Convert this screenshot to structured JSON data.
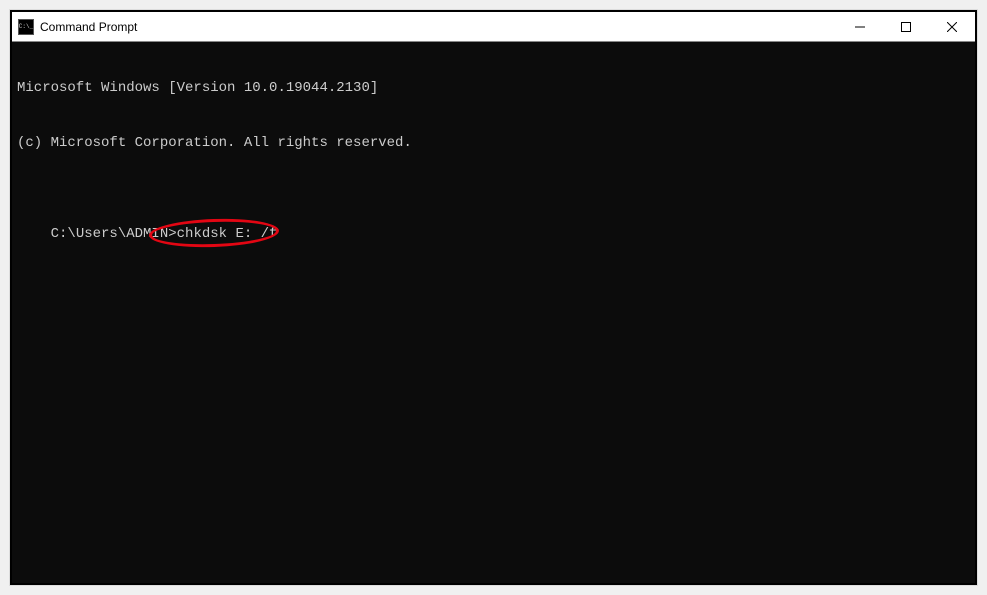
{
  "window": {
    "title": "Command Prompt"
  },
  "terminal": {
    "line1": "Microsoft Windows [Version 10.0.19044.2130]",
    "line2": "(c) Microsoft Corporation. All rights reserved.",
    "prompt": "C:\\Users\\ADMIN>",
    "command": "chkdsk E: /f"
  },
  "annotation": {
    "highlight_target": "command-text"
  }
}
